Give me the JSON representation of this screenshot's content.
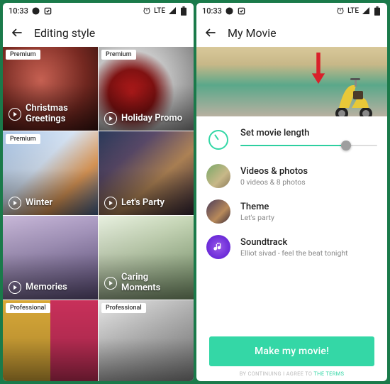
{
  "status": {
    "time": "10:33",
    "net": "LTE"
  },
  "left": {
    "title": "Editing style",
    "badges": {
      "premium": "Premium",
      "professional": "Professional"
    },
    "tiles": [
      {
        "label": "Christmas Greetings",
        "badge": "premium"
      },
      {
        "label": "Holiday Promo",
        "badge": "premium"
      },
      {
        "label": "Winter",
        "badge": "premium"
      },
      {
        "label": "Let's Party",
        "badge": null
      },
      {
        "label": "Memories",
        "badge": null
      },
      {
        "label": "Caring Moments",
        "badge": null
      },
      {
        "label": "",
        "badge": "professional"
      },
      {
        "label": "",
        "badge": "professional"
      }
    ]
  },
  "right": {
    "title": "My Movie",
    "rows": {
      "length": {
        "title": "Set movie length"
      },
      "media": {
        "title": "Videos & photos",
        "sub": "0 videos  & 8 photos"
      },
      "theme": {
        "title": "Theme",
        "sub": "Let's party"
      },
      "sound": {
        "title": "Soundtrack",
        "sub": "Elliot sivad - feel the beat tonight"
      }
    },
    "cta": "Make my movie!",
    "terms_pre": "BY CONTINUING I AGREE TO ",
    "terms_link": "THE TERMS"
  }
}
